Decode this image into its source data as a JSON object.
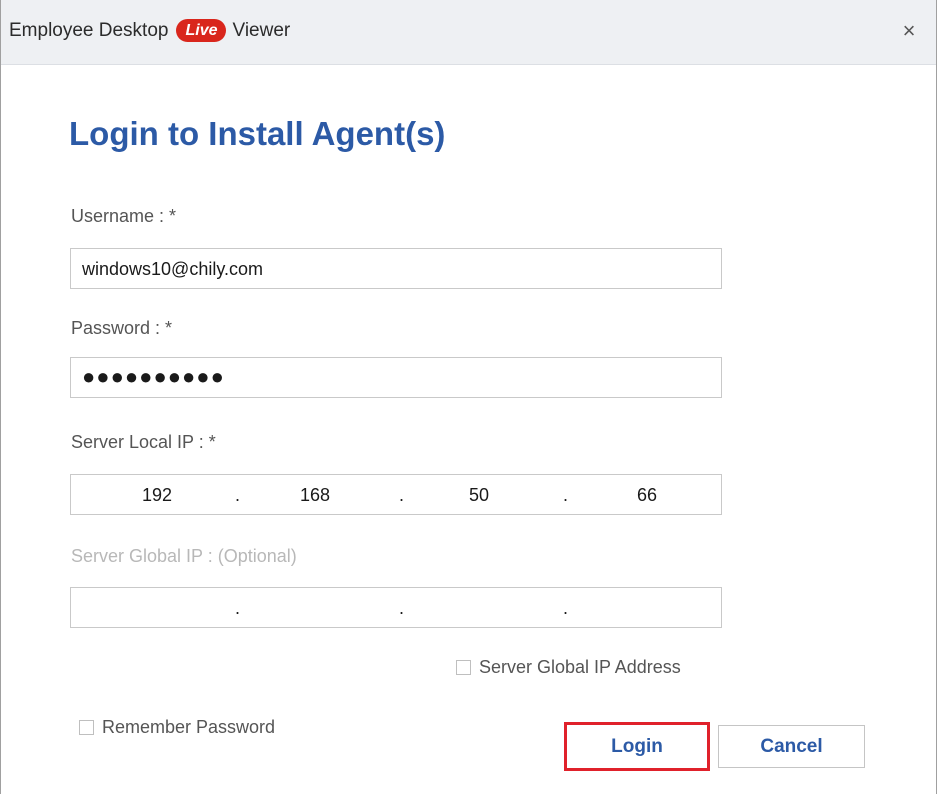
{
  "window": {
    "title_prefix": "Employee Desktop",
    "live_badge": "Live",
    "title_suffix": "Viewer",
    "close_glyph": "×"
  },
  "form": {
    "heading": "Login to Install Agent(s)",
    "username": {
      "label": "Username : *",
      "value": "windows10@chily.com"
    },
    "password": {
      "label": "Password : *",
      "masked_value": "●●●●●●●●●●"
    },
    "server_local_ip": {
      "label": "Server Local IP : *",
      "octets": [
        "192",
        "168",
        "50",
        "66"
      ],
      "separator": "."
    },
    "server_global_ip": {
      "label": "Server Global IP : (Optional)",
      "octets": [
        "",
        "",
        "",
        ""
      ],
      "separator": "."
    },
    "server_global_ip_checkbox": {
      "label": "Server Global IP Address",
      "checked": false
    },
    "remember_password_checkbox": {
      "label": "Remember Password",
      "checked": false
    }
  },
  "buttons": {
    "login": "Login",
    "cancel": "Cancel"
  },
  "colors": {
    "heading": "#2c5aa6",
    "live_badge": "#d9261c",
    "login_highlight": "#e0212b"
  }
}
